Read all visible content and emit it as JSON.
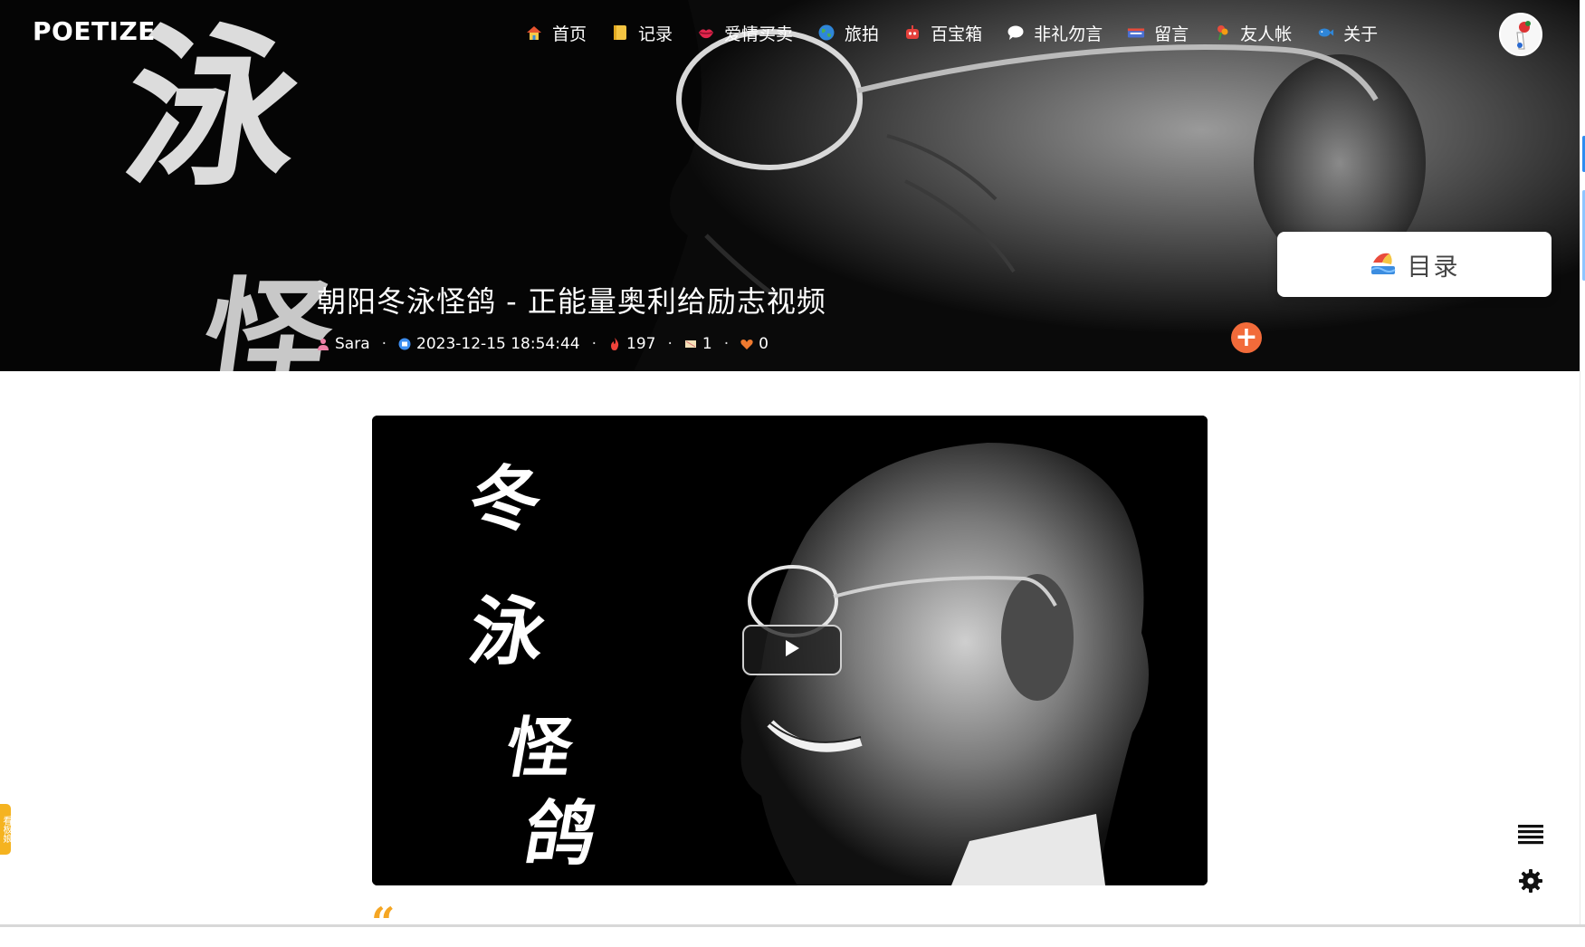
{
  "site": {
    "logo": "POETIZE"
  },
  "nav": {
    "items": [
      {
        "label": "首页",
        "icon": "home-icon"
      },
      {
        "label": "记录",
        "icon": "notebook-icon"
      },
      {
        "label": "爱情买卖",
        "icon": "lips-icon"
      },
      {
        "label": "旅拍",
        "icon": "globe-icon"
      },
      {
        "label": "百宝箱",
        "icon": "robot-icon"
      },
      {
        "label": "非礼勿言",
        "icon": "speech-bubble-icon"
      },
      {
        "label": "留言",
        "icon": "flag-icon"
      },
      {
        "label": "友人帐",
        "icon": "flower-icon"
      },
      {
        "label": "关于",
        "icon": "fish-icon"
      }
    ]
  },
  "article": {
    "title": "朝阳冬泳怪鸽 - 正能量奥利给励志视频",
    "author": "Sara",
    "datetime": "2023-12-15 18:54:44",
    "views": "197",
    "comments": "1",
    "likes": "0"
  },
  "toc": {
    "label": "目录"
  },
  "hero": {
    "calligraphy": [
      "泳",
      "怪"
    ]
  },
  "video": {
    "calligraphy": [
      "冬",
      "泳",
      "怪",
      "鸽"
    ]
  },
  "side_tab": {
    "label": "看板娘"
  },
  "colors": {
    "accent_orange": "#f26b3a",
    "quote_yellow": "#f5a623",
    "side_tab_yellow": "#f5b320"
  }
}
